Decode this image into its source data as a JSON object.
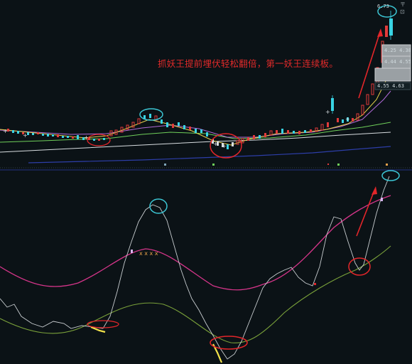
{
  "annotation": {
    "text": "抓妖王提前埋伏轻松翻倍，第一妖王连续板。"
  },
  "header": {
    "top_value": "6.73",
    "top_icons": "〒 ⊡"
  },
  "price_labels": [
    {
      "text": "4.25  4.38"
    },
    {
      "text": "4.44  4.55"
    },
    {
      "text": "4.55  4.63"
    }
  ],
  "colors": {
    "background": "#0b1216",
    "bullish_candle": "#e23b3b",
    "bearish_candle": "#39d4e4",
    "ma_yellow": "#e6d24a",
    "ma_purple": "#b06ad8",
    "ma_green": "#6fcf5a",
    "ma_white": "#d8dde0",
    "ma_blue": "#2d3ea8",
    "osc_white": "#c8cdd0",
    "osc_magenta": "#d6358a",
    "osc_green": "#7aa13a",
    "circle_cyan": "#3cc6d4",
    "circle_red": "#e3262a",
    "arrow_red": "#e3262a"
  }
}
